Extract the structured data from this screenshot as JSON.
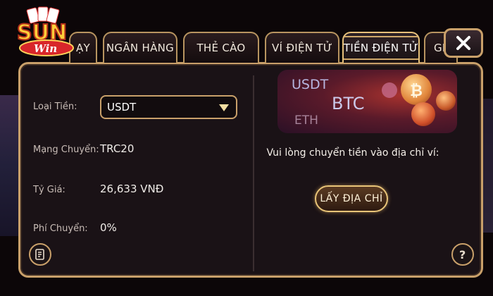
{
  "tabs": [
    {
      "label": "ẠY"
    },
    {
      "label": "NGÂN HÀNG"
    },
    {
      "label": "THẺ CÀO"
    },
    {
      "label": "VÍ ĐIỆN TỬ"
    },
    {
      "label": "TIỀN ĐIỆN TỬ"
    },
    {
      "label": "GI"
    }
  ],
  "active_tab": "TIỀN ĐIỆN TỬ",
  "logo": {
    "main_text": "SUN",
    "sub_text": "Win"
  },
  "form": {
    "currency_label": "Loại Tiền:",
    "currency_value": "USDT",
    "network_label": "Mạng Chuyển:",
    "network_value": "TRC20",
    "rate_label": "Tỷ Giá:",
    "rate_value": "26,633 VNĐ",
    "fee_label": "Phí Chuyển:",
    "fee_value": "0%"
  },
  "banner": {
    "usdt": "USDT",
    "btc": "BTC",
    "eth": "ETH"
  },
  "deposit": {
    "instruction": "Vui lòng chuyển tiền vào địa chỉ ví:",
    "get_address_label": "LẤY ĐỊA CHỈ"
  },
  "colors": {
    "gold": "#c9a06a",
    "panel": "#1a1216",
    "accent_gold": "#e8c478"
  },
  "icons": [
    "close-icon",
    "history-icon",
    "help-icon",
    "bitcoin-icon"
  ]
}
